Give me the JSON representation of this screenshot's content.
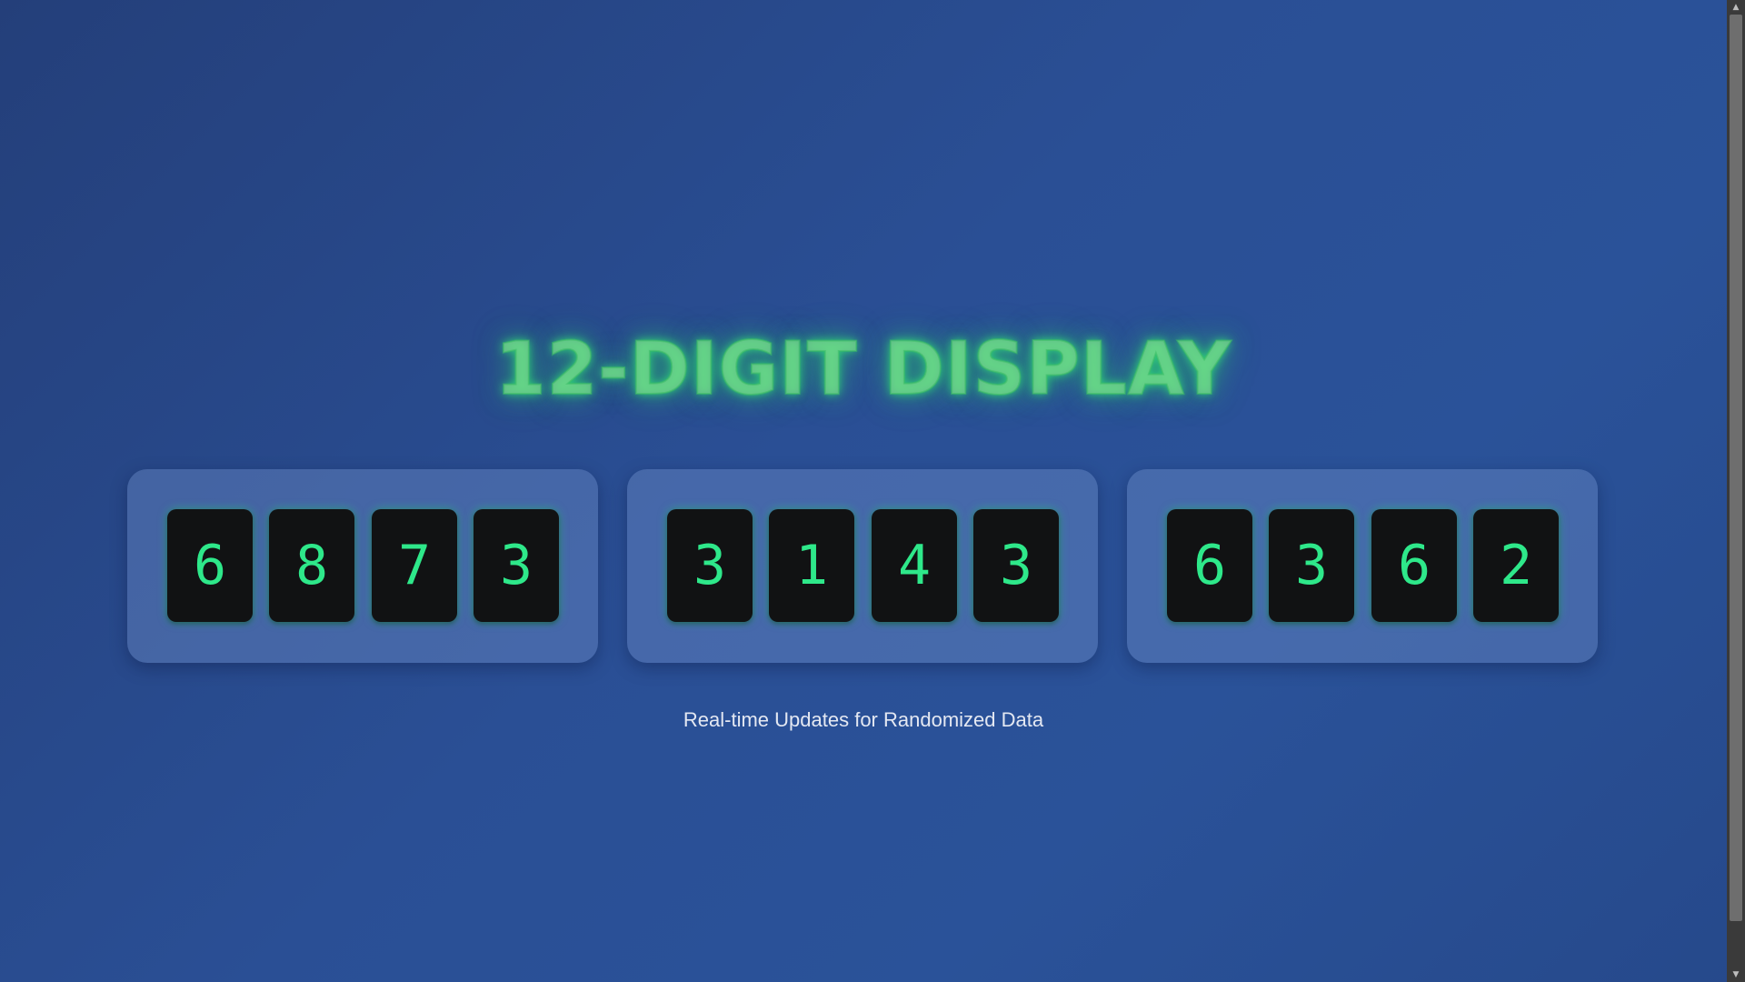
{
  "title": "12-DIGIT DISPLAY",
  "groups": [
    {
      "digits": [
        "6",
        "8",
        "7",
        "3"
      ]
    },
    {
      "digits": [
        "3",
        "1",
        "4",
        "3"
      ]
    },
    {
      "digits": [
        "6",
        "3",
        "6",
        "2"
      ]
    }
  ],
  "subtitle": "Real-time Updates for Randomized Data",
  "icons": {
    "scroll_up": "chevron-up-icon",
    "scroll_down": "chevron-down-icon"
  },
  "colors": {
    "background": "#2a4f95",
    "digit_text": "#2ee88a",
    "digit_tile": "#111213",
    "title_glow": "#3ecf72"
  }
}
